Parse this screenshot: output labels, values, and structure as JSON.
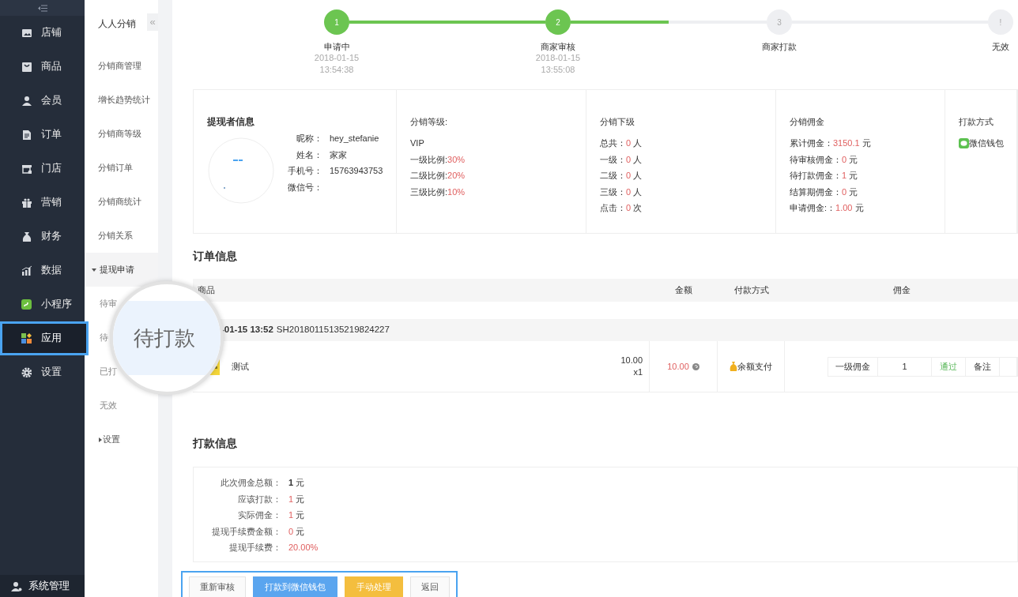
{
  "sidebar": {
    "items": [
      {
        "label": "店铺",
        "selected": false
      },
      {
        "label": "商品",
        "selected": false
      },
      {
        "label": "会员",
        "selected": false
      },
      {
        "label": "订单",
        "selected": false
      },
      {
        "label": "门店",
        "selected": false
      },
      {
        "label": "营销",
        "selected": false
      },
      {
        "label": "财务",
        "selected": false
      },
      {
        "label": "数据",
        "selected": false
      },
      {
        "label": "小程序",
        "selected": false
      },
      {
        "label": "应用",
        "selected": true
      },
      {
        "label": "设置",
        "selected": false
      }
    ],
    "footer": {
      "label": "系统管理"
    }
  },
  "submenu": {
    "title": "人人分销",
    "collapse": "«",
    "items": [
      {
        "kind": "link",
        "label": "分销商管理"
      },
      {
        "kind": "link",
        "label": "增长趋势统计"
      },
      {
        "kind": "link",
        "label": "分销商等级"
      },
      {
        "kind": "link",
        "label": "分销订单"
      },
      {
        "kind": "link",
        "label": "分销商统计"
      },
      {
        "kind": "link",
        "label": "分销关系"
      },
      {
        "kind": "group",
        "label": "提现申请",
        "expanded": true,
        "children": [
          {
            "label": "待审",
            "selected": false
          },
          {
            "label": "待",
            "selected": true
          },
          {
            "label": "已打",
            "selected": false
          },
          {
            "label": "无效",
            "selected": false
          }
        ]
      },
      {
        "kind": "group",
        "label": "设置",
        "expanded": false
      }
    ]
  },
  "magnifier": {
    "text": "待打款"
  },
  "steps": [
    {
      "number": "1",
      "label": "申请中",
      "date": "2018-01-15",
      "time": "13:54:38",
      "done": true
    },
    {
      "number": "2",
      "label": "商家审核",
      "date": "2018-01-15",
      "time": "13:55:08",
      "done": true
    },
    {
      "number": "3",
      "label": "商家打款",
      "done": false
    },
    {
      "number": "!",
      "label": "无效",
      "done": false
    }
  ],
  "info": [
    {
      "kind": "profile",
      "title": "提现者信息",
      "rows": [
        {
          "label": "昵称：",
          "value": "hey_stefanie"
        },
        {
          "label": "姓名：",
          "value": "家家"
        },
        {
          "label": "手机号：",
          "value": "15763943753"
        },
        {
          "label": "微信号："
        }
      ]
    },
    {
      "kind": "stats",
      "title": "分销等级:",
      "rows": [
        {
          "label": "VIP"
        },
        {
          "label": "一级比例:",
          "value": "30%"
        },
        {
          "label": "二级比例:",
          "value": "20%"
        },
        {
          "label": "三级比例:",
          "value": "10%"
        }
      ]
    },
    {
      "kind": "stats",
      "title": "分销下级",
      "rows": [
        {
          "label": "总共：",
          "value": "0",
          "unit": "人"
        },
        {
          "label": "一级：",
          "value": "0",
          "unit": "人"
        },
        {
          "label": "二级：",
          "value": "0",
          "unit": "人"
        },
        {
          "label": "三级：",
          "value": "0",
          "unit": "人"
        },
        {
          "label": "点击：",
          "value": "0",
          "unit": "次"
        }
      ]
    },
    {
      "kind": "stats",
      "title": "分销佣金",
      "rows": [
        {
          "label": "累计佣金：",
          "value": "3150.1",
          "unit": "元"
        },
        {
          "label": "待审核佣金：",
          "value": "0",
          "unit": "元"
        },
        {
          "label": "待打款佣金：",
          "value": "1",
          "unit": "元"
        },
        {
          "label": "结算期佣金：",
          "value": "0",
          "unit": "元"
        },
        {
          "label": "申请佣金:：",
          "value": "1.00",
          "unit": "元"
        }
      ]
    },
    {
      "kind": "method",
      "title": "打款方式",
      "rows": [
        {
          "label": "微信钱包"
        }
      ]
    }
  ],
  "order_section": {
    "title": "订单信息",
    "columns": [
      "商品",
      "金额",
      "付款方式",
      "佣金"
    ],
    "order": {
      "date": "-01-15 13:52",
      "number": "SH20180115135219824227"
    },
    "items": [
      {
        "name": "测试",
        "price": "10.00",
        "quantity": "x1",
        "amount": "10.00",
        "payment": "余额支付",
        "commission": {
          "level": "一级佣金",
          "value": "1",
          "status": "通过",
          "note": "备注"
        }
      }
    ]
  },
  "payment_section": {
    "title": "打款信息",
    "rows": [
      {
        "label": "此次佣金总额：",
        "value": "1",
        "unit": "元",
        "kind": "bold"
      },
      {
        "label": "应该打款：",
        "value": "1",
        "unit": "元",
        "kind": "red"
      },
      {
        "label": "实际佣金：",
        "value": "1",
        "unit": "元",
        "kind": "red"
      },
      {
        "label": "提现手续费金额：",
        "value": "0",
        "unit": "元",
        "kind": "red"
      },
      {
        "label": "提现手续费：",
        "value": "20.00%",
        "kind": "red"
      }
    ]
  },
  "actions": {
    "highlighted": true,
    "buttons": [
      {
        "label": "重新审核",
        "kind": "default"
      },
      {
        "label": "打款到微信钱包",
        "kind": "primary"
      },
      {
        "label": "手动处理",
        "kind": "warning"
      },
      {
        "label": "返回",
        "kind": "default"
      }
    ]
  }
}
